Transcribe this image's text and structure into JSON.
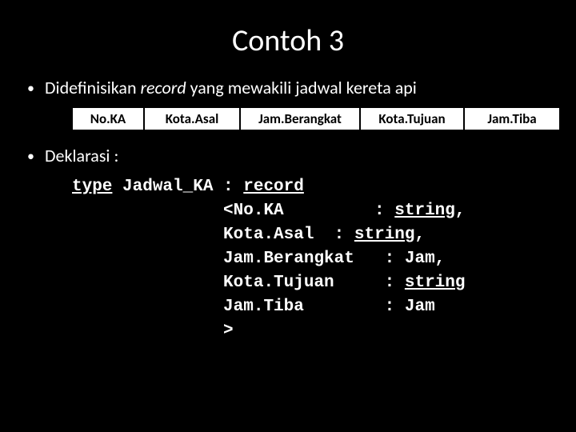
{
  "title": "Contoh 3",
  "bullet1_pre": "Didefinisikan ",
  "bullet1_em": "record",
  "bullet1_post": " yang mewakili jadwal kereta api",
  "headers": {
    "c1": "No.KA",
    "c2": "Kota.Asal",
    "c3": "Jam.Berangkat",
    "c4": "Kota.Tujuan",
    "c5": "Jam.Tiba"
  },
  "bullet2": "Deklarasi :",
  "code": {
    "l1a": "type",
    "l1b": " Jadwal_KA : ",
    "l1c": "record",
    "l2a": "               <No.KA         : ",
    "l2b": "string",
    "l2c": ",",
    "l3a": "               Kota.Asal  : ",
    "l3b": "string",
    "l3c": ",",
    "l4": "               Jam.Berangkat   : Jam,",
    "l5a": "               Kota.Tujuan     : ",
    "l5b": "string",
    "l6": "               Jam.Tiba        : Jam",
    "l7": "               >"
  }
}
